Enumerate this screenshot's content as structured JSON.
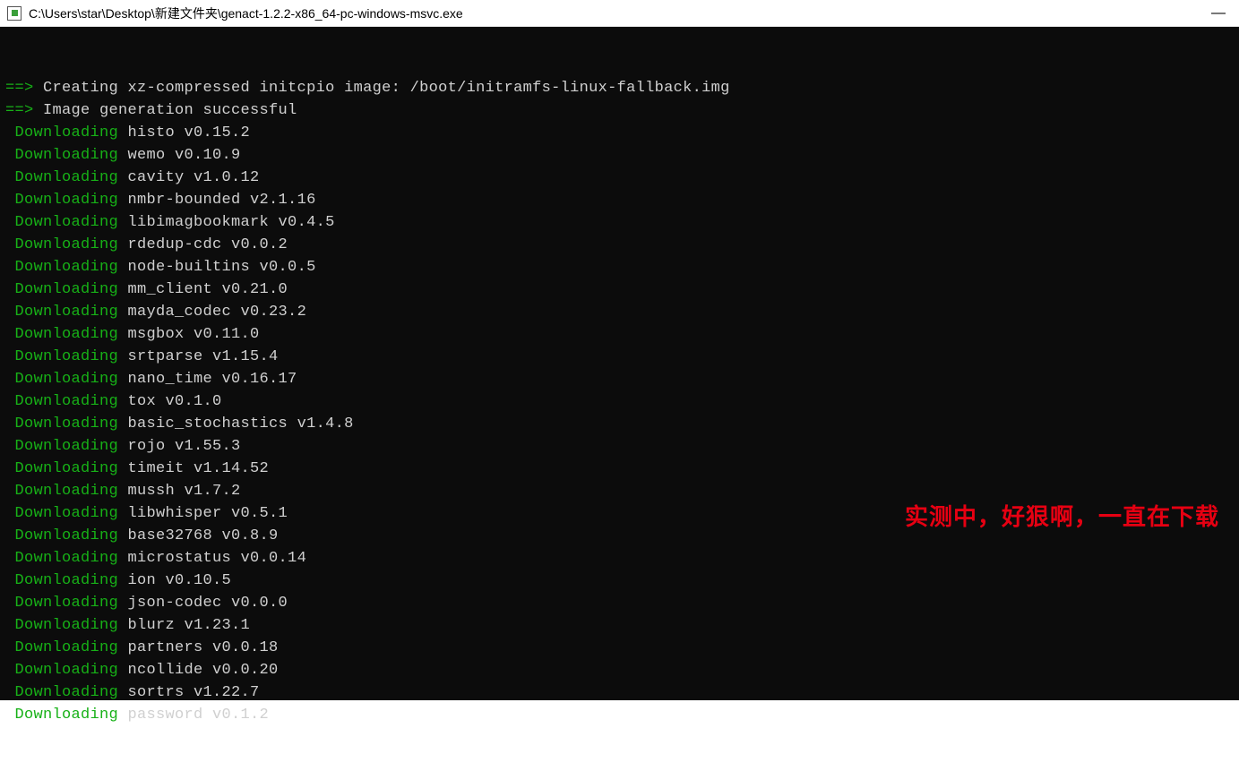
{
  "window": {
    "title": "C:\\Users\\star\\Desktop\\新建文件夹\\genact-1.2.2-x86_64-pc-windows-msvc.exe",
    "minimize": "—"
  },
  "header_lines": [
    {
      "arrow": "==>",
      "text": "Creating xz-compressed initcpio image: /boot/initramfs-linux-fallback.img"
    },
    {
      "arrow": "==>",
      "text": "Image generation successful"
    }
  ],
  "downloading_label": "Downloading",
  "downloads": [
    {
      "pkg": "histo v0.15.2"
    },
    {
      "pkg": "wemo v0.10.9"
    },
    {
      "pkg": "cavity v1.0.12"
    },
    {
      "pkg": "nmbr-bounded v2.1.16"
    },
    {
      "pkg": "libimagbookmark v0.4.5"
    },
    {
      "pkg": "rdedup-cdc v0.0.2"
    },
    {
      "pkg": "node-builtins v0.0.5"
    },
    {
      "pkg": "mm_client v0.21.0"
    },
    {
      "pkg": "mayda_codec v0.23.2"
    },
    {
      "pkg": "msgbox v0.11.0"
    },
    {
      "pkg": "srtparse v1.15.4"
    },
    {
      "pkg": "nano_time v0.16.17"
    },
    {
      "pkg": "tox v0.1.0"
    },
    {
      "pkg": "basic_stochastics v1.4.8"
    },
    {
      "pkg": "rojo v1.55.3"
    },
    {
      "pkg": "timeit v1.14.52"
    },
    {
      "pkg": "mussh v1.7.2"
    },
    {
      "pkg": "libwhisper v0.5.1"
    },
    {
      "pkg": "base32768 v0.8.9"
    },
    {
      "pkg": "microstatus v0.0.14"
    },
    {
      "pkg": "ion v0.10.5"
    },
    {
      "pkg": "json-codec v0.0.0"
    },
    {
      "pkg": "blurz v1.23.1"
    },
    {
      "pkg": "partners v0.0.18"
    },
    {
      "pkg": "ncollide v0.0.20"
    },
    {
      "pkg": "sortrs v1.22.7"
    },
    {
      "pkg": "password v0.1.2"
    }
  ],
  "overlay_text": "实测中，好狠啊，一直在下载"
}
